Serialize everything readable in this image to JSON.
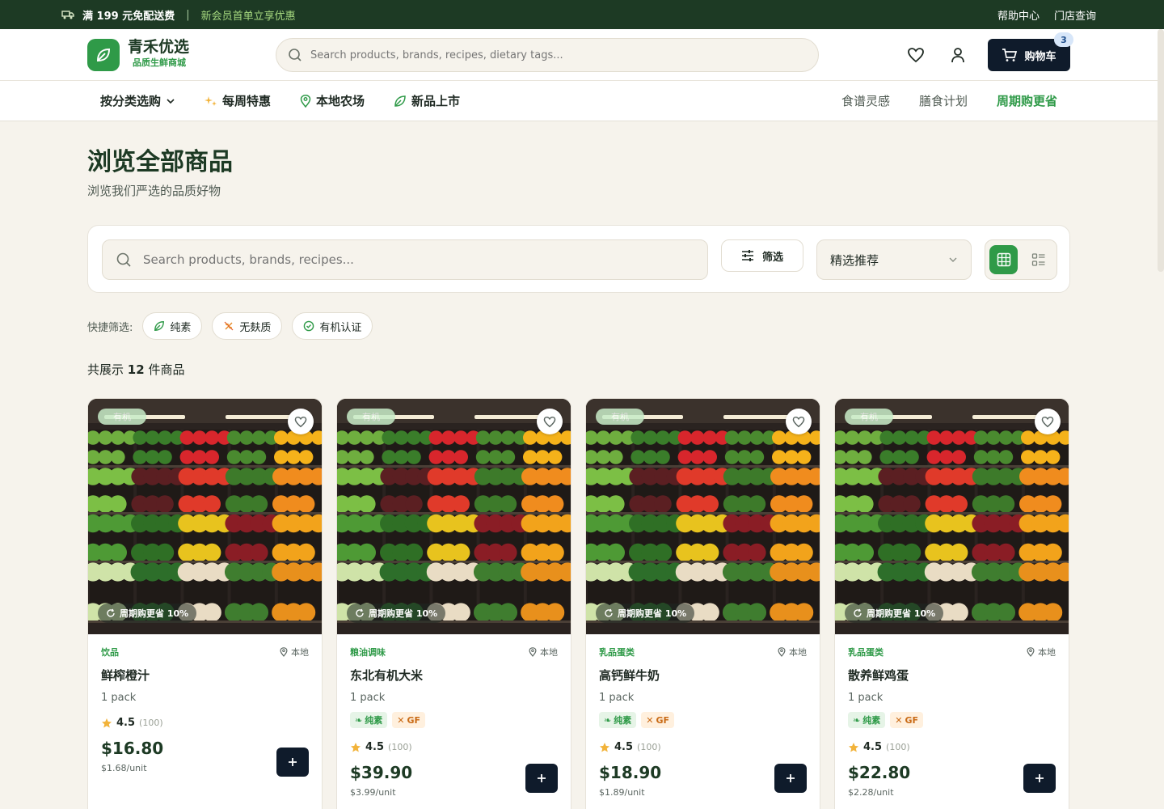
{
  "topbar": {
    "shipping": "满 199 元免配送费",
    "separator": "|",
    "member": "新会员首单立享优惠",
    "help": "帮助中心",
    "store": "门店查询"
  },
  "header": {
    "logo_name": "青禾优选",
    "logo_tagline": "品质生鲜商城",
    "search_placeholder": "Search products, brands, recipes, dietary tags...",
    "cart_label": "购物车",
    "cart_count": "3"
  },
  "nav": {
    "left": [
      {
        "label": "按分类选购",
        "icon": "chevron-down-icon"
      },
      {
        "label": "每周特惠",
        "icon": "sparkle-icon"
      },
      {
        "label": "本地农场",
        "icon": "location-pin-icon"
      },
      {
        "label": "新品上市",
        "icon": "leaf-icon"
      }
    ],
    "right": [
      {
        "label": "食谱灵感"
      },
      {
        "label": "膳食计划"
      },
      {
        "label": "周期购更省"
      }
    ]
  },
  "page": {
    "title": "浏览全部商品",
    "subtitle": "浏览我们严选的品质好物"
  },
  "toolbar": {
    "search_placeholder": "Search products, brands, recipes...",
    "filter_label": "筛选",
    "sort_value": "精选推荐"
  },
  "quick_filters": {
    "label": "快捷筛选:",
    "chips": [
      "纯素",
      "无麸质",
      "有机认证"
    ]
  },
  "result": {
    "prefix": "共展示",
    "count": "12",
    "suffix": "件商品"
  },
  "products": [
    {
      "category": "饮品",
      "origin": "本地",
      "name": "鲜榨橙汁",
      "unit": "1 pack",
      "tags": [],
      "rating": "4.5",
      "reviews": "(100)",
      "price": "$16.80",
      "per_unit": "$1.68/unit",
      "subscribe": "周期购更省 10%",
      "badge": "有机"
    },
    {
      "category": "粮油调味",
      "origin": "本地",
      "name": "东北有机大米",
      "unit": "1 pack",
      "tags": [
        "纯素",
        "GF"
      ],
      "rating": "4.5",
      "reviews": "(100)",
      "price": "$39.90",
      "per_unit": "$3.99/unit",
      "subscribe": "周期购更省 10%",
      "badge": "有机"
    },
    {
      "category": "乳品蛋类",
      "origin": "本地",
      "name": "高钙鲜牛奶",
      "unit": "1 pack",
      "tags": [
        "纯素",
        "GF"
      ],
      "rating": "4.5",
      "reviews": "(100)",
      "price": "$18.90",
      "per_unit": "$1.89/unit",
      "subscribe": "周期购更省 10%",
      "badge": "有机"
    },
    {
      "category": "乳品蛋类",
      "origin": "本地",
      "name": "散养鲜鸡蛋",
      "unit": "1 pack",
      "tags": [
        "纯素",
        "GF"
      ],
      "rating": "4.5",
      "reviews": "(100)",
      "price": "$22.80",
      "per_unit": "$2.28/unit",
      "subscribe": "周期购更省 10%",
      "badge": "有机"
    }
  ],
  "colors": {
    "brand_green": "#2f9a48",
    "dark_green": "#1d3a24",
    "navy": "#0f1b2b",
    "background": "#f6f3ec"
  }
}
